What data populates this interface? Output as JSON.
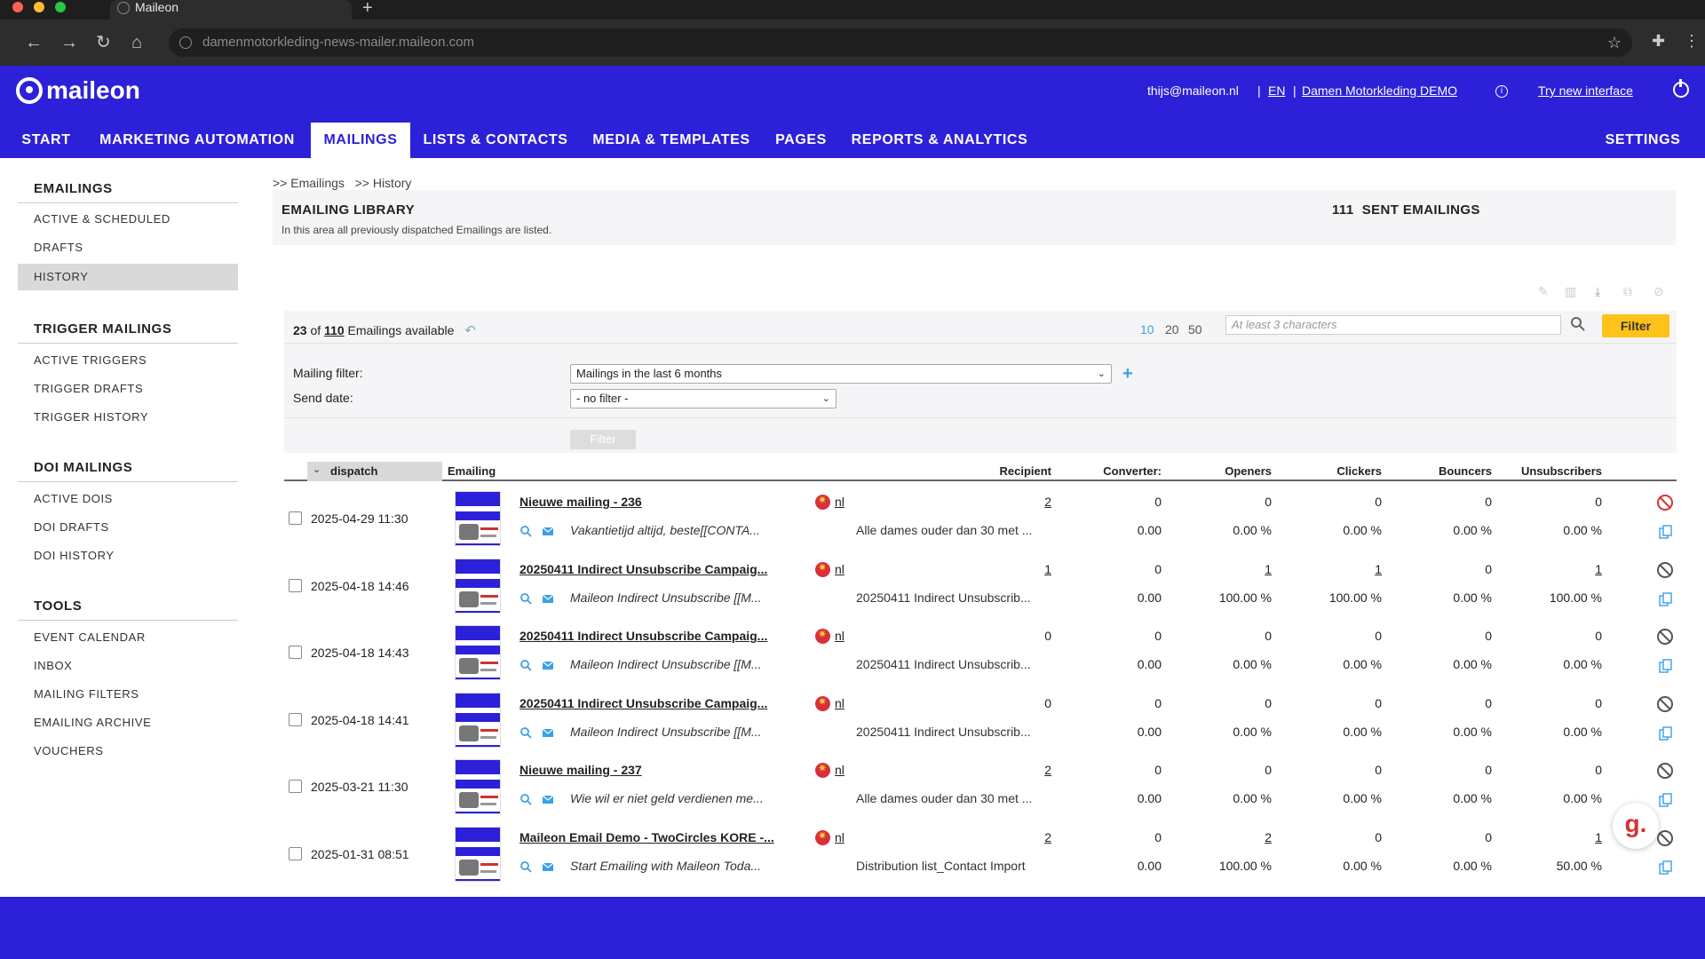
{
  "browser": {
    "tab_title": "Maileon",
    "url": "damenmotorkleding-news-mailer.maileon.com"
  },
  "header": {
    "logo_text": "maileon",
    "user_email": "thijs@maileon.nl",
    "language": "EN",
    "account": "Damen Motorkleding DEMO",
    "try_new": "Try new interface",
    "separator": "|"
  },
  "nav": {
    "items": [
      "START",
      "MARKETING AUTOMATION",
      "MAILINGS",
      "LISTS & CONTACTS",
      "MEDIA & TEMPLATES",
      "PAGES",
      "REPORTS & ANALYTICS"
    ],
    "active": "MAILINGS",
    "settings": "SETTINGS"
  },
  "sidebar": {
    "sections": [
      {
        "title": "EMAILINGS",
        "items": [
          "ACTIVE & SCHEDULED",
          "DRAFTS",
          "HISTORY"
        ]
      },
      {
        "title": "TRIGGER MAILINGS",
        "items": [
          "ACTIVE TRIGGERS",
          "TRIGGER DRAFTS",
          "TRIGGER HISTORY"
        ]
      },
      {
        "title": "DOI MAILINGS",
        "items": [
          "ACTIVE DOIS",
          "DOI DRAFTS",
          "DOI HISTORY"
        ]
      },
      {
        "title": "TOOLS",
        "items": [
          "EVENT CALENDAR",
          "INBOX",
          "MAILING FILTERS",
          "EMAILING ARCHIVE",
          "VOUCHERS"
        ]
      }
    ],
    "active_item": "HISTORY"
  },
  "breadcrumb": ">> Emailings   >> History",
  "library": {
    "title": "EMAILING LIBRARY",
    "subtitle": "In this area all previously dispatched Emailings are listed.",
    "sent_count": "111",
    "sent_label": "SENT EMAILINGS"
  },
  "listing": {
    "shown": "23",
    "of": "of",
    "total": "110",
    "available_label": "Emailings available",
    "page_sizes": [
      "10",
      "20",
      "50"
    ],
    "active_page_size": "10",
    "search_placeholder": "At least 3 characters",
    "filter_button": "Filter"
  },
  "filters": {
    "mailing_filter_label": "Mailing filter:",
    "mailing_filter_value": "Mailings in the last 6 months",
    "send_date_label": "Send date:",
    "send_date_value": "- no filter -",
    "apply_button": "Filter"
  },
  "table": {
    "columns": {
      "dispatch": "dispatch",
      "emailing": "Emailing",
      "recipient": "Recipient",
      "converter": "Converter:",
      "openers": "Openers",
      "clickers": "Clickers",
      "bouncers": "Bouncers",
      "unsubscribers": "Unsubscribers"
    },
    "rows": [
      {
        "date": "2025-04-29 11:30",
        "name": "Nieuwe mailing - 236",
        "lang": "nl",
        "subject": "Vakantietijd altijd, beste[[CONTA...",
        "recipient_list": "Alle dames ouder dan 30 met ...",
        "recipient": "2",
        "converter": "0",
        "openers": "0",
        "clickers": "0",
        "bouncers": "0",
        "unsubscribers": "0",
        "converter_rate": "0.00",
        "openers_rate": "0.00 %",
        "clickers_rate": "0.00 %",
        "bouncers_rate": "0.00 %",
        "unsub_rate": "0.00 %"
      },
      {
        "date": "2025-04-18 14:46",
        "name": "20250411 Indirect Unsubscribe Campaig...",
        "lang": "nl",
        "subject": "Maileon Indirect Unsubscribe [[M...",
        "recipient_list": "20250411 Indirect Unsubscrib...",
        "recipient": "1",
        "converter": "0",
        "openers": "1",
        "clickers": "1",
        "bouncers": "0",
        "unsubscribers": "1",
        "converter_rate": "0.00",
        "openers_rate": "100.00 %",
        "clickers_rate": "100.00 %",
        "bouncers_rate": "0.00 %",
        "unsub_rate": "100.00 %"
      },
      {
        "date": "2025-04-18 14:43",
        "name": "20250411 Indirect Unsubscribe Campaig...",
        "lang": "nl",
        "subject": "Maileon Indirect Unsubscribe [[M...",
        "recipient_list": "20250411 Indirect Unsubscrib...",
        "recipient": "0",
        "converter": "0",
        "openers": "0",
        "clickers": "0",
        "bouncers": "0",
        "unsubscribers": "0",
        "converter_rate": "0.00",
        "openers_rate": "0.00 %",
        "clickers_rate": "0.00 %",
        "bouncers_rate": "0.00 %",
        "unsub_rate": "0.00 %"
      },
      {
        "date": "2025-04-18 14:41",
        "name": "20250411 Indirect Unsubscribe Campaig...",
        "lang": "nl",
        "subject": "Maileon Indirect Unsubscribe [[M...",
        "recipient_list": "20250411 Indirect Unsubscrib...",
        "recipient": "0",
        "converter": "0",
        "openers": "0",
        "clickers": "0",
        "bouncers": "0",
        "unsubscribers": "0",
        "converter_rate": "0.00",
        "openers_rate": "0.00 %",
        "clickers_rate": "0.00 %",
        "bouncers_rate": "0.00 %",
        "unsub_rate": "0.00 %"
      },
      {
        "date": "2025-03-21 11:30",
        "name": "Nieuwe mailing - 237",
        "lang": "nl",
        "subject": "Wie wil er niet geld verdienen me...",
        "recipient_list": "Alle dames ouder dan 30 met ...",
        "recipient": "2",
        "converter": "0",
        "openers": "0",
        "clickers": "0",
        "bouncers": "0",
        "unsubscribers": "0",
        "converter_rate": "0.00",
        "openers_rate": "0.00 %",
        "clickers_rate": "0.00 %",
        "bouncers_rate": "0.00 %",
        "unsub_rate": "0.00 %"
      },
      {
        "date": "2025-01-31 08:51",
        "name": "Maileon Email Demo - TwoCircles KORE -...",
        "lang": "nl",
        "subject": "Start Emailing with Maileon Toda...",
        "recipient_list": "Distribution list_Contact Import",
        "recipient": "2",
        "converter": "0",
        "openers": "2",
        "clickers": "0",
        "bouncers": "0",
        "unsubscribers": "1",
        "converter_rate": "0.00",
        "openers_rate": "100.00 %",
        "clickers_rate": "0.00 %",
        "bouncers_rate": "0.00 %",
        "unsub_rate": "50.00 %"
      }
    ]
  },
  "widget": {
    "badge": "g."
  }
}
